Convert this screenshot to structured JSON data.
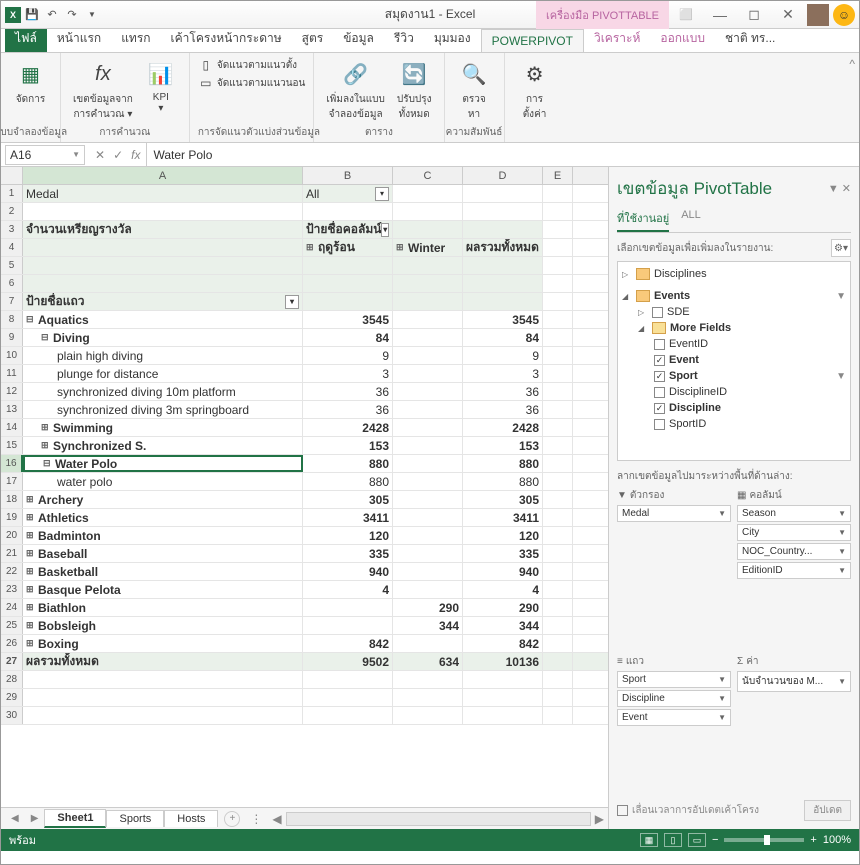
{
  "title": "สมุดงาน1 - Excel",
  "pivot_tool": "เครื่องมือ PIVOTTABLE",
  "tabs": {
    "file": "ไฟล์",
    "home": "หน้าแรก",
    "insert": "แทรก",
    "layout": "เค้าโครงหน้ากระดาษ",
    "formulas": "สูตร",
    "data": "ข้อมูล",
    "review": "รีวิว",
    "view": "มุมมอง",
    "powerpivot": "POWERPIVOT",
    "analyze": "วิเคราะห์",
    "design": "ออกแบบ",
    "more": "ชาติ ทร..."
  },
  "ribbon": {
    "g1": {
      "btn": "จัดการ",
      "label": "แบบจำลองข้อมูล"
    },
    "g2": {
      "btn1": "เขตข้อมูลจาก\nการคำนวณ ▾",
      "btn2": "KPI\n▾",
      "label": "การคำนวณ"
    },
    "g3": {
      "i1": "จัดแนวตามแนวตั้ง",
      "i2": "จัดแนวตามแนวนอน",
      "label": "การจัดแนวตัวแบ่งส่วนข้อมูล"
    },
    "g4": {
      "btn1": "เพิ่มลงในแบบ\nจำลองข้อมูล",
      "btn2": "ปรับปรุง\nทั้งหมด",
      "label": "ตาราง"
    },
    "g5": {
      "btn": "ตรวจ\nหา",
      "label": "ความสัมพันธ์"
    },
    "g6": {
      "btn": "การ\nตั้งค่า"
    }
  },
  "namebox": "A16",
  "formula": "Water Polo",
  "cols": {
    "A": "A",
    "B": "B",
    "C": "C",
    "D": "D",
    "E": "E"
  },
  "cells": {
    "r1a": "Medal",
    "r1b": "All",
    "r3a": "จำนวนเหรียญรางวัล",
    "r3b": "ป้ายชื่อคอลัมน์",
    "r4b": "ฤดูร้อน",
    "r4c": "Winter",
    "r4d": "ผลรวมทั้งหมด",
    "r7a": "ป้ายชื่อแถว",
    "r8a": "Aquatics",
    "r8b": "3545",
    "r8d": "3545",
    "r9a": "Diving",
    "r9b": "84",
    "r9d": "84",
    "r10a": "plain high diving",
    "r10b": "9",
    "r10d": "9",
    "r11a": "plunge for distance",
    "r11b": "3",
    "r11d": "3",
    "r12a": "synchronized diving 10m platform",
    "r12b": "36",
    "r12d": "36",
    "r13a": "synchronized diving 3m springboard",
    "r13b": "36",
    "r13d": "36",
    "r14a": "Swimming",
    "r14b": "2428",
    "r14d": "2428",
    "r15a": "Synchronized S.",
    "r15b": "153",
    "r15d": "153",
    "r16a": "Water Polo",
    "r16b": "880",
    "r16d": "880",
    "r17a": "water polo",
    "r17b": "880",
    "r17d": "880",
    "r18a": "Archery",
    "r18b": "305",
    "r18d": "305",
    "r19a": "Athletics",
    "r19b": "3411",
    "r19d": "3411",
    "r20a": "Badminton",
    "r20b": "120",
    "r20d": "120",
    "r21a": "Baseball",
    "r21b": "335",
    "r21d": "335",
    "r22a": "Basketball",
    "r22b": "940",
    "r22d": "940",
    "r23a": "Basque Pelota",
    "r23b": "4",
    "r23d": "4",
    "r24a": "Biathlon",
    "r24c": "290",
    "r24d": "290",
    "r25a": "Bobsleigh",
    "r25c": "344",
    "r25d": "344",
    "r26a": "Boxing",
    "r26b": "842",
    "r26d": "842",
    "r27a": "ผลรวมทั้งหมด",
    "r27b": "9502",
    "r27c": "634",
    "r27d": "10136"
  },
  "sheets": {
    "s1": "Sheet1",
    "s2": "Sports",
    "s3": "Hosts"
  },
  "field_pane": {
    "title": "เขตข้อมูล PivotTable",
    "tab1": "ที่ใช้งานอยู่",
    "tab2": "ALL",
    "hint": "เลือกเขตข้อมูลเพื่อเพิ่มลงในรายงาน:",
    "disciplines": "Disciplines",
    "events": "Events",
    "sde": "SDE",
    "more": "More Fields",
    "eventid": "EventID",
    "event": "Event",
    "sport": "Sport",
    "disciplineid": "DisciplineID",
    "discipline": "Discipline",
    "sportid": "SportID",
    "drag_hint": "ลากเขตข้อมูลไปมาระหว่างพื้นที่ด้านล่าง:",
    "filters_lbl": "ตัวกรอง",
    "cols_lbl": "คอลัมน์",
    "rows_lbl": "แถว",
    "vals_lbl": "ค่า",
    "filter1": "Medal",
    "col1": "Season",
    "col2": "City",
    "col3": "NOC_Country...",
    "col4": "EditionID",
    "row1": "Sport",
    "row2": "Discipline",
    "row3": "Event",
    "val1": "นับจำนวนของ M...",
    "defer": "เลื่อนเวลาการอัปเดตเค้าโครง",
    "update": "อัปเดต"
  },
  "status": {
    "ready": "พร้อม",
    "zoom": "100%"
  }
}
